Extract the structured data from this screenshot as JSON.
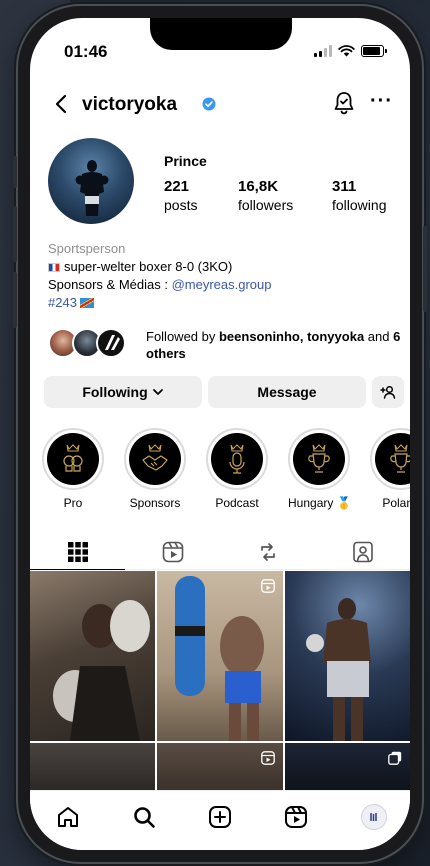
{
  "status_bar": {
    "time": "01:46",
    "battery_level": 0.9
  },
  "header": {
    "username": "victoryoka",
    "verified": true,
    "more_label": "···"
  },
  "profile": {
    "display_name": "Prince",
    "stats": [
      {
        "value": "221",
        "label": "posts"
      },
      {
        "value": "16,8K",
        "label": "followers"
      },
      {
        "value": "311",
        "label": "following"
      }
    ],
    "bio": {
      "category": "Sportsperson",
      "line1": "super-welter boxer 8-0 (3KO)",
      "line2_prefix": "Sponsors & Médias : ",
      "line2_link": "@meyreas.group",
      "hashtag": "#243"
    },
    "followed_by": {
      "prefix": "Followed by ",
      "names": "beensoninho, tonyyoka",
      "middle": " and ",
      "others": "6 others"
    }
  },
  "buttons": {
    "following": "Following",
    "message": "Message"
  },
  "highlights": [
    {
      "label": "Pro",
      "icon": "boxing-gloves-icon"
    },
    {
      "label": "Sponsors",
      "icon": "handshake-icon"
    },
    {
      "label": "Podcast",
      "icon": "microphone-icon"
    },
    {
      "label": "Hungary 🥇",
      "icon": "trophy-icon"
    },
    {
      "label": "Poland",
      "icon": "trophy-icon"
    }
  ],
  "tabs": [
    "grid-icon",
    "reels-icon",
    "reposts-icon",
    "tagged-icon"
  ],
  "bottom_nav": [
    "home-icon",
    "search-icon",
    "create-icon",
    "reels-icon",
    "profile-icon"
  ],
  "colors": {
    "verified": "#3897f0",
    "link": "#3b57a8",
    "button_bg": "#efefef",
    "highlight_gold": "#c9a55a"
  }
}
